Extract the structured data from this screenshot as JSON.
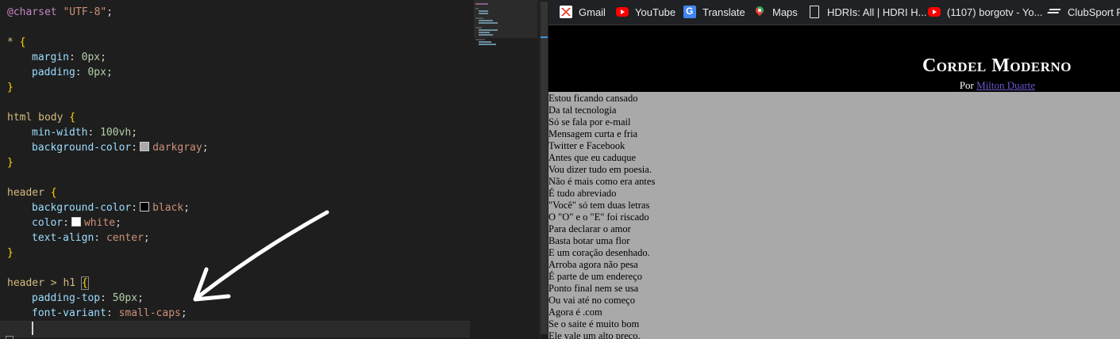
{
  "editor": {
    "charset_rule": "@charset",
    "charset_value": "\"UTF-8\"",
    "rules": [
      {
        "selector": "*",
        "decls": [
          {
            "prop": "margin",
            "value": "0px"
          },
          {
            "prop": "padding",
            "value": "0px"
          }
        ]
      },
      {
        "selector": "html body",
        "decls": [
          {
            "prop": "min-width",
            "value": "100vh"
          },
          {
            "prop": "background-color",
            "value": "darkgray",
            "swatch": "#a9a9a9"
          }
        ]
      },
      {
        "selector": "header",
        "decls": [
          {
            "prop": "background-color",
            "value": "black",
            "swatch": "#000000"
          },
          {
            "prop": "color",
            "value": "white",
            "swatch": "#ffffff"
          },
          {
            "prop": "text-align",
            "value": "center"
          }
        ]
      },
      {
        "selector": "header > h1",
        "decls": [
          {
            "prop": "padding-top",
            "value": "50px"
          },
          {
            "prop": "font-variant",
            "value": "small-caps"
          }
        ]
      }
    ]
  },
  "browser": {
    "bookmarks": [
      {
        "label": "Gmail",
        "icon": "gmail-icon"
      },
      {
        "label": "YouTube",
        "icon": "youtube-icon"
      },
      {
        "label": "Translate",
        "icon": "translate-icon"
      },
      {
        "label": "Maps",
        "icon": "maps-icon"
      },
      {
        "label": "HDRIs: All | HDRI H...",
        "icon": "document-icon"
      },
      {
        "label": "(1107) borgotv - Yo...",
        "icon": "youtube-icon"
      },
      {
        "label": "ClubSport Pe",
        "icon": "clubsport-icon"
      }
    ],
    "page": {
      "title": "Cordel Moderno",
      "byline_prefix": "Por",
      "author": "Milton Duarte",
      "poem_lines": [
        "Estou ficando cansado",
        "Da tal tecnologia",
        "Só se fala por e-mail",
        "Mensagem curta e fria",
        "Twitter e Facebook",
        "Antes que eu caduque",
        "Vou dizer tudo em poesia.",
        "Não é mais como era antes",
        "É tudo abreviado",
        "\"Você\" só tem duas letras",
        "O \"O\" e o \"E\" foi riscado",
        "Para declarar o amor",
        "Basta botar uma flor",
        "E um coração desenhado.",
        "Arroba agora não pesa",
        "É parte de um endereço",
        "Ponto final nem se usa",
        "Ou vai até no começo",
        "Agora é .com",
        "Se o saite é muito bom",
        "Ele vale um alto preço."
      ]
    }
  }
}
